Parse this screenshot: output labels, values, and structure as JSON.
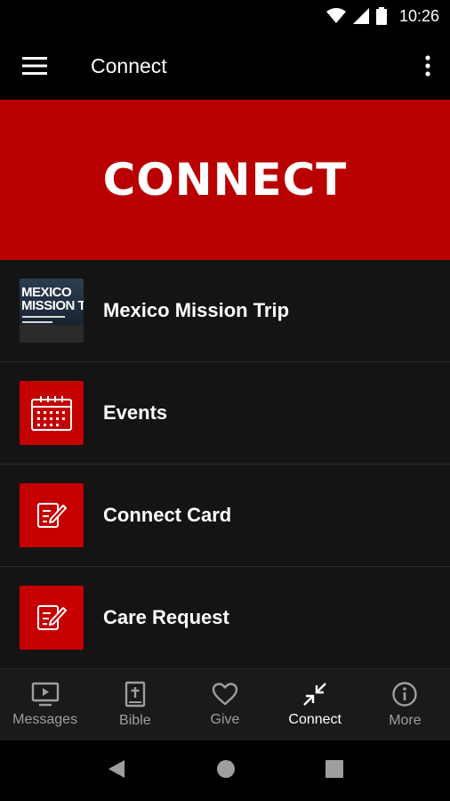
{
  "status_bar": {
    "time": "10:26",
    "icons": [
      "wifi-icon",
      "signal-icon",
      "battery-icon"
    ]
  },
  "app_bar": {
    "title": "Connect",
    "menu_icon": "hamburger-menu-icon",
    "overflow_icon": "more-vert-icon"
  },
  "banner": {
    "text": "CONNECT",
    "color": "#b80000"
  },
  "list": {
    "items": [
      {
        "label": "Mexico Mission Trip",
        "icon": "mexico-mission-trip-thumbnail",
        "thumb_title": "MEXICO\nMISSION TRI"
      },
      {
        "label": "Events",
        "icon": "calendar-icon"
      },
      {
        "label": "Connect Card",
        "icon": "edit-note-icon"
      },
      {
        "label": "Care Request",
        "icon": "edit-note-icon"
      }
    ]
  },
  "bottom_nav": {
    "items": [
      {
        "label": "Messages",
        "icon": "tv-play-icon",
        "active": false
      },
      {
        "label": "Bible",
        "icon": "bible-icon",
        "active": false
      },
      {
        "label": "Give",
        "icon": "heart-icon",
        "active": false
      },
      {
        "label": "Connect",
        "icon": "collapse-arrows-icon",
        "active": true
      },
      {
        "label": "More",
        "icon": "info-icon",
        "active": false
      }
    ]
  },
  "system_nav": {
    "icons": [
      "back-icon",
      "home-icon",
      "recents-icon"
    ]
  },
  "colors": {
    "accent": "#c40000",
    "background": "#141414",
    "nav_inactive": "#9e9e9e"
  }
}
